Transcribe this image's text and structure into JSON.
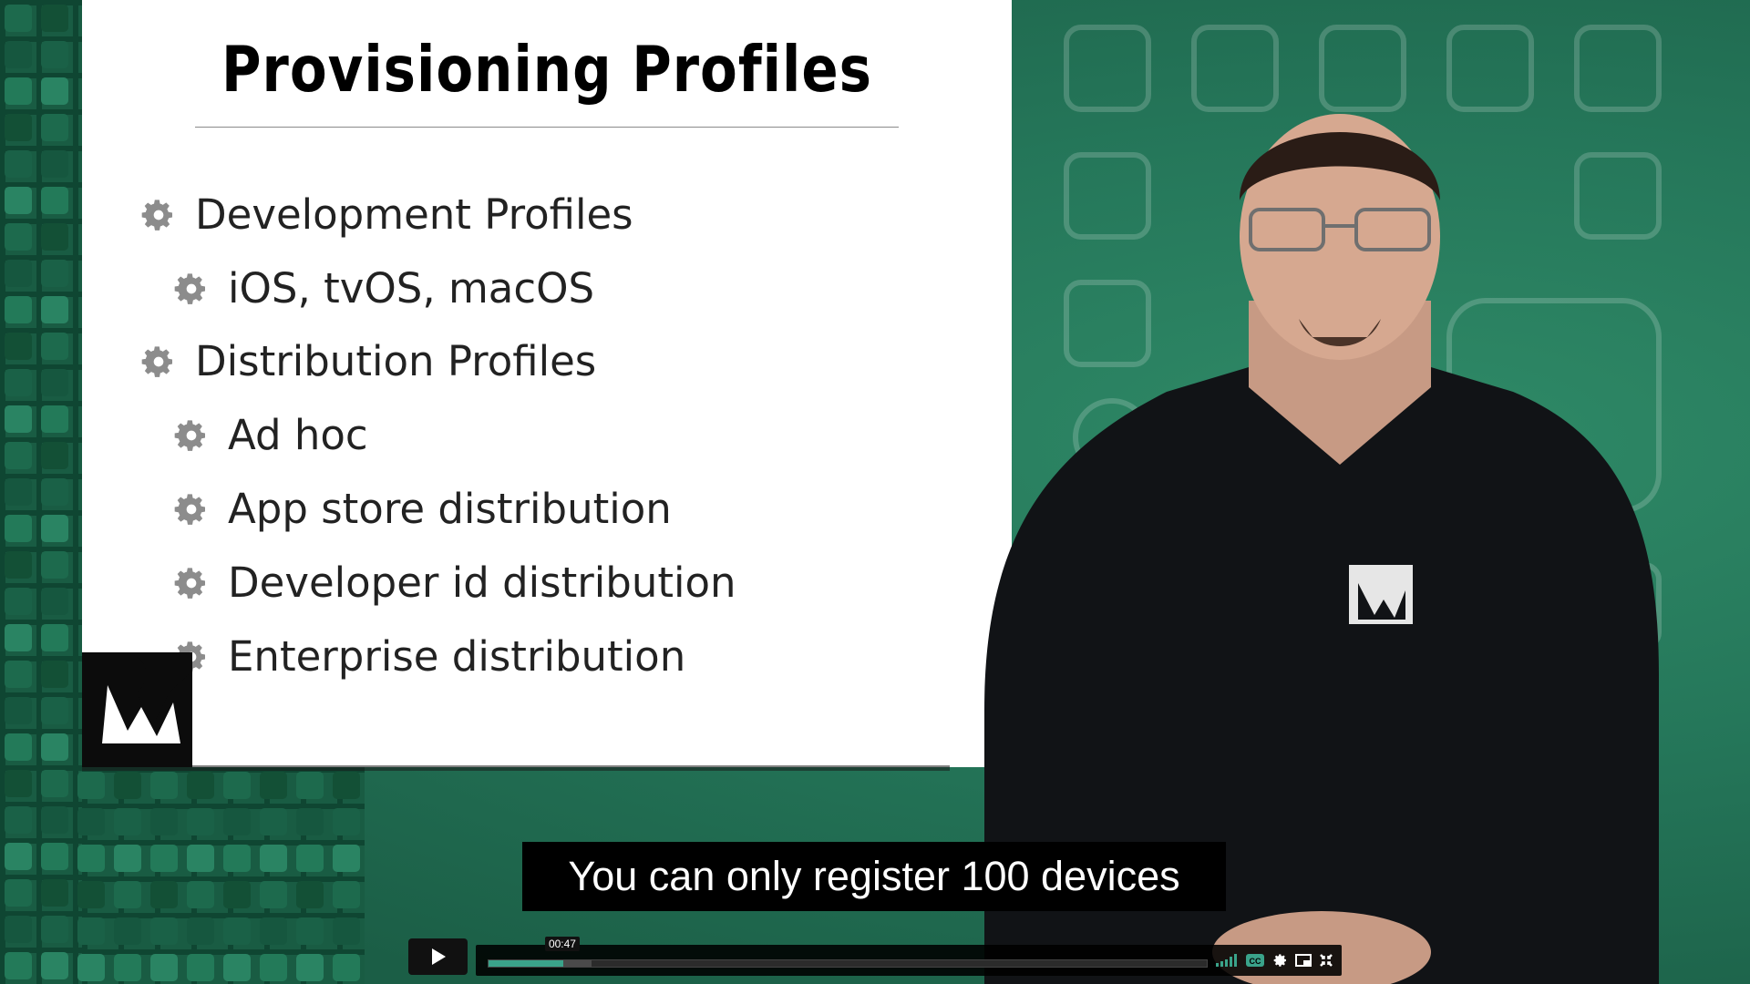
{
  "slide": {
    "title": "Provisioning Profiles",
    "bullets": [
      {
        "text": "Development Profiles",
        "level": 1
      },
      {
        "text": "iOS, tvOS, macOS",
        "level": 2
      },
      {
        "text": "Distribution Profiles",
        "level": 1
      },
      {
        "text": "Ad hoc",
        "level": 2
      },
      {
        "text": "App store distribution",
        "level": 2
      },
      {
        "text": "Developer id distribution",
        "level": 2
      },
      {
        "text": "Enterprise distribution",
        "level": 2
      }
    ]
  },
  "caption": {
    "text": "You can only register 100 devices"
  },
  "player": {
    "current_time": "00:47",
    "progress_fraction": 0.104,
    "buffered_fraction": 0.143,
    "icons": [
      "play-icon",
      "volume-icon",
      "closed-captions-icon",
      "settings-gear-icon",
      "picture-in-picture-icon",
      "fullscreen-icon"
    ]
  },
  "colors": {
    "accent": "#3aa38a",
    "background_green": "#1f5a44",
    "caption_bg": "#000000"
  }
}
